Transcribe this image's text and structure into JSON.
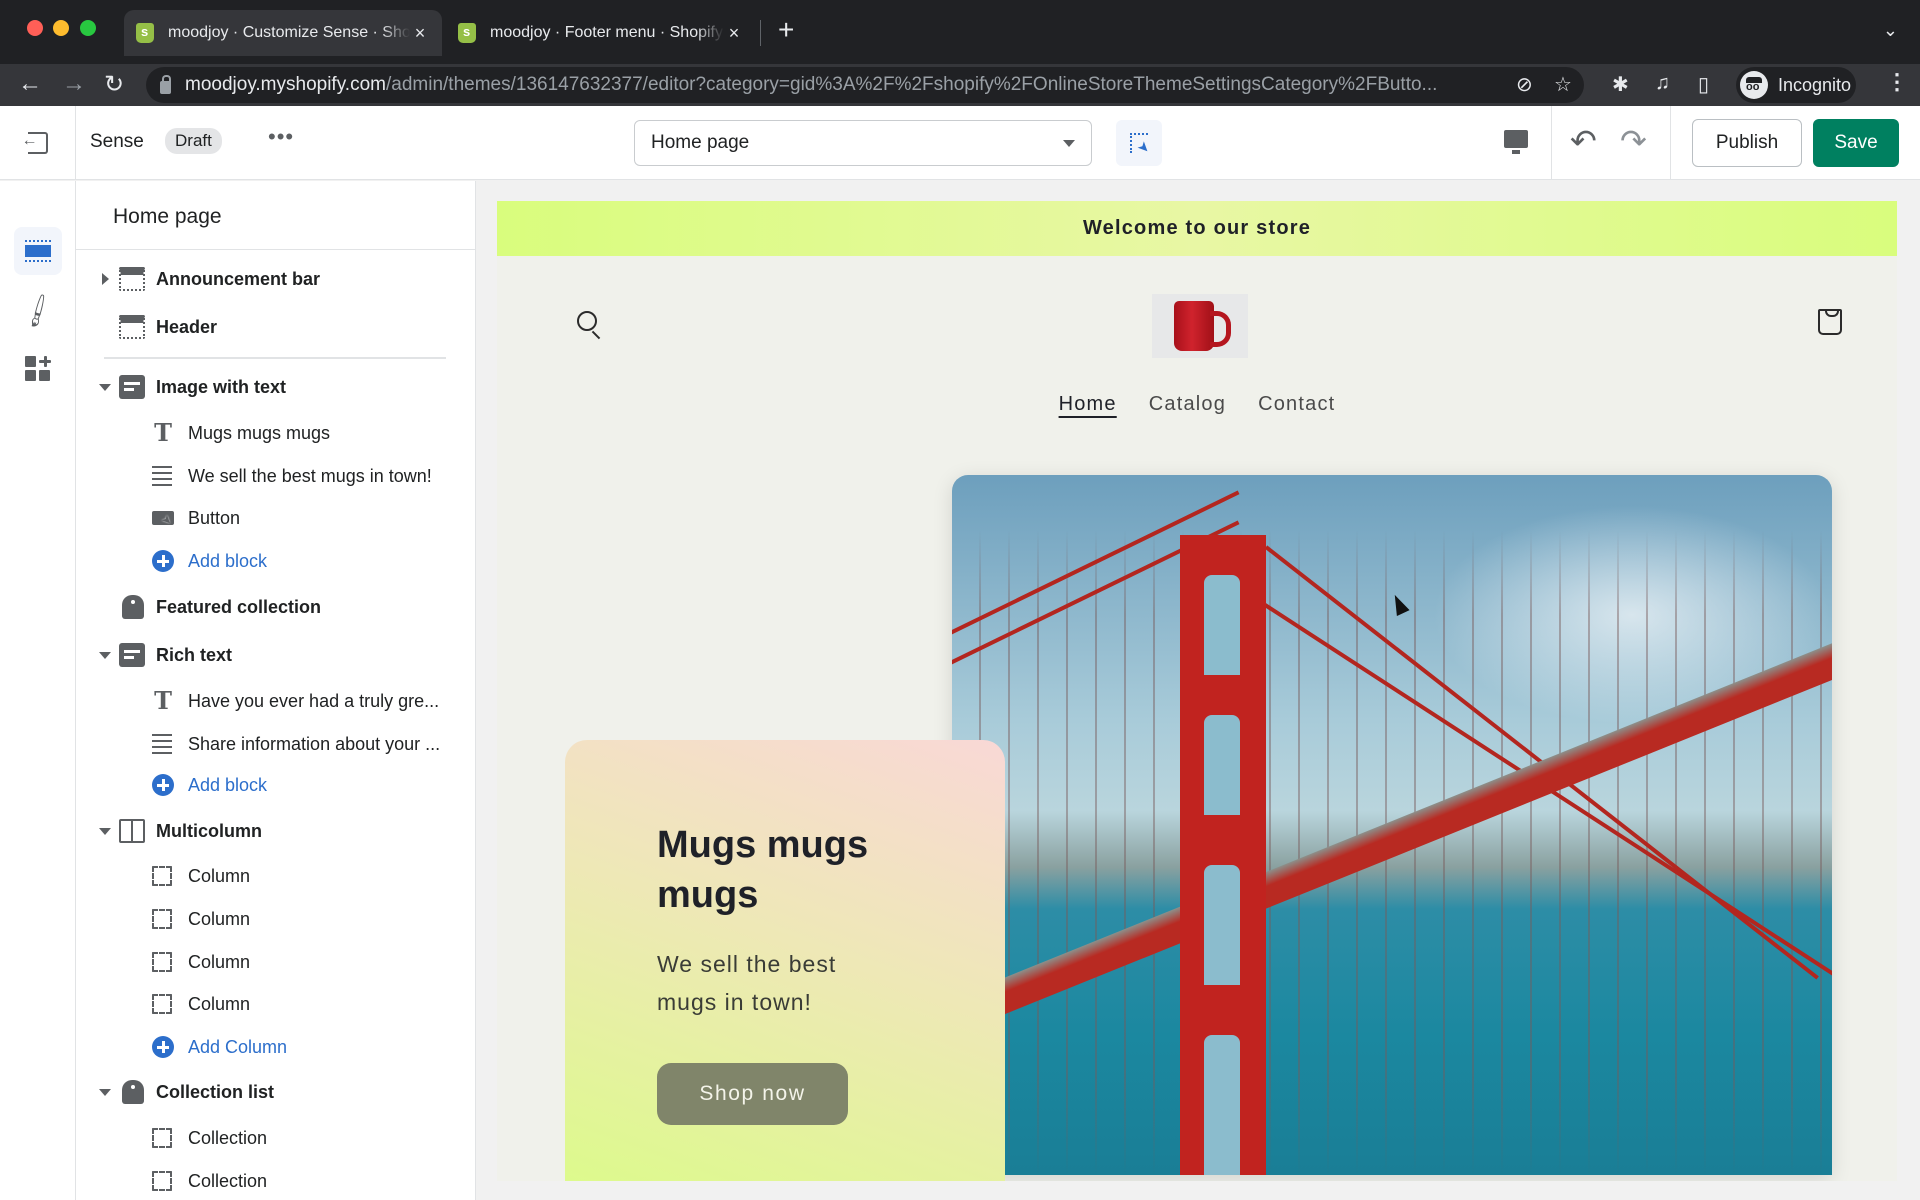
{
  "browser": {
    "tabs": [
      {
        "title": "moodjoy · Customize Sense · Shopify",
        "active": true,
        "close": "×"
      },
      {
        "title": "moodjoy · Footer menu · Shopify",
        "active": false,
        "close": "×"
      }
    ],
    "new_tab": "+",
    "tab_search": "⌄",
    "url_host": "moodjoy.myshopify.com",
    "url_path": "/admin/themes/136147632377/editor?category=gid%3A%2F%2Fshopify%2FOnlineStoreThemeSettingsCategory%2FButto...",
    "profile_label": "Incognito",
    "nav": {
      "back": "←",
      "forward": "→",
      "reload": "↻"
    },
    "icons": {
      "eye_off": "⊘",
      "star": "☆",
      "extensions": "✱",
      "media": "♫",
      "sidepanel": "▯",
      "menu": "⋮"
    }
  },
  "editor": {
    "theme_name": "Sense",
    "status_badge": "Draft",
    "more": "•••",
    "page_selector": {
      "selected": "Home page"
    },
    "undo": "↶",
    "redo": "↷",
    "publish_label": "Publish",
    "save_label": "Save",
    "colors": {
      "save": "#008060",
      "accent": "#2c6ecb"
    }
  },
  "sidebar": {
    "title": "Home page",
    "sections": [
      {
        "label": "Announcement bar",
        "icon": "header-section-icon",
        "expanded": false,
        "has_chevron": true
      },
      {
        "label": "Header",
        "icon": "header-section-icon",
        "has_chevron": false
      },
      {
        "label": "Image with text",
        "icon": "text-section-icon",
        "expanded": true,
        "blocks": [
          {
            "label": "Mugs mugs mugs",
            "icon": "heading-icon"
          },
          {
            "label": "We sell the best mugs in town!",
            "icon": "paragraph-icon"
          },
          {
            "label": "Button",
            "icon": "button-icon"
          },
          {
            "label": "Add block",
            "icon": "add-icon",
            "add": true
          }
        ]
      },
      {
        "label": "Featured collection",
        "icon": "collection-icon",
        "has_chevron": false
      },
      {
        "label": "Rich text",
        "icon": "text-section-icon",
        "expanded": true,
        "blocks": [
          {
            "label": "Have you ever had a truly gre...",
            "icon": "heading-icon"
          },
          {
            "label": "Share information about your ...",
            "icon": "paragraph-icon"
          },
          {
            "label": "Add block",
            "icon": "add-icon",
            "add": true
          }
        ]
      },
      {
        "label": "Multicolumn",
        "icon": "columns-icon",
        "expanded": true,
        "blocks": [
          {
            "label": "Column",
            "icon": "frame-icon"
          },
          {
            "label": "Column",
            "icon": "frame-icon"
          },
          {
            "label": "Column",
            "icon": "frame-icon"
          },
          {
            "label": "Column",
            "icon": "frame-icon"
          },
          {
            "label": "Add Column",
            "icon": "add-icon",
            "add": true
          }
        ]
      },
      {
        "label": "Collection list",
        "icon": "collection-icon",
        "expanded": true,
        "blocks": [
          {
            "label": "Collection",
            "icon": "frame-icon"
          },
          {
            "label": "Collection",
            "icon": "frame-icon"
          }
        ]
      }
    ]
  },
  "preview": {
    "announcement": "Welcome to our store",
    "nav_links": [
      "Home",
      "Catalog",
      "Contact"
    ],
    "active_nav": "Home",
    "hero": {
      "heading": "Mugs mugs mugs",
      "text": "We sell the best mugs in town!",
      "button": "Shop now"
    },
    "colors": {
      "announcement_bg": "#d9fd7d",
      "page_bg": "#f0f1eb",
      "button_bg": "#80856a"
    }
  }
}
